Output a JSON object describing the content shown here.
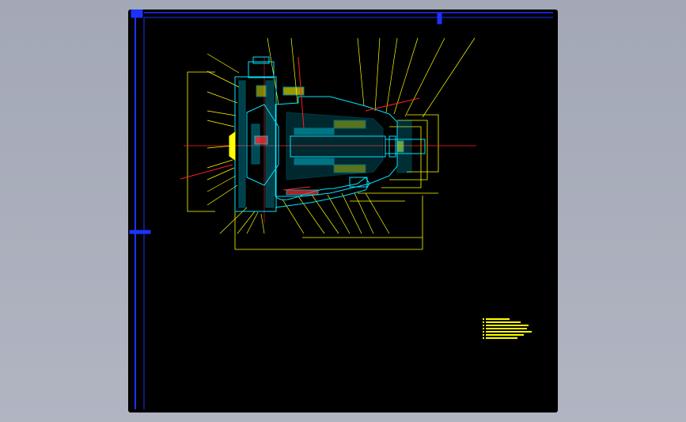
{
  "drawing": {
    "background": "#000000",
    "viewport_background": "#a8adba",
    "frame_color": "#1c32ff",
    "part_color": "#00e5ff",
    "leader_color": "#ffff00",
    "centerline_color": "#ff2020",
    "annotation_color": "#ffff00",
    "tech_notes": "",
    "callouts": []
  }
}
